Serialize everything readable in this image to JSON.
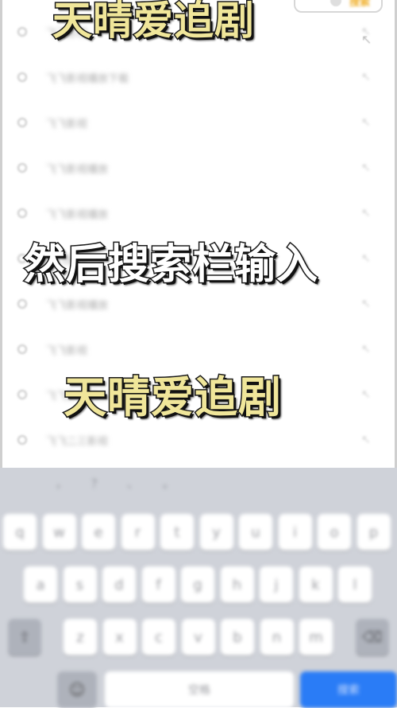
{
  "header": {
    "search_button_label": "搜索",
    "fill_arrow": "↖"
  },
  "suggestions": [
    {
      "text": "飞飞影视"
    },
    {
      "text": "飞飞影视播放下载"
    },
    {
      "text": "飞飞影视"
    },
    {
      "text": "飞飞影视播放"
    },
    {
      "text": "飞飞影视播放"
    },
    {
      "text": "飞飞影视"
    },
    {
      "text": "飞飞影视播放"
    },
    {
      "text": "飞飞影视"
    },
    {
      "text": "飞飞影视播放"
    },
    {
      "text": "飞飞二三影视"
    }
  ],
  "captions": {
    "top": "天晴爱追剧",
    "middle": "然后搜索栏输入",
    "bottom": "天晴爱追剧"
  },
  "keyboard": {
    "predictions": [
      "，",
      "？",
      "、",
      "。"
    ],
    "row1": [
      "q",
      "w",
      "e",
      "r",
      "t",
      "y",
      "u",
      "i",
      "o",
      "p"
    ],
    "row2": [
      "a",
      "s",
      "d",
      "f",
      "g",
      "h",
      "j",
      "k",
      "l"
    ],
    "row3": [
      "z",
      "x",
      "c",
      "v",
      "b",
      "n",
      "m"
    ],
    "shift_key": "⇧",
    "backspace_key": "⌫",
    "emoji_key": "☺",
    "space_label": "空格",
    "search_label": "搜索"
  },
  "colors": {
    "caption_yellow": "#f0e69a",
    "caption_white": "#ffffff",
    "search_key_blue": "#2a7cf6",
    "keyboard_bg": "#cfd2d9"
  }
}
